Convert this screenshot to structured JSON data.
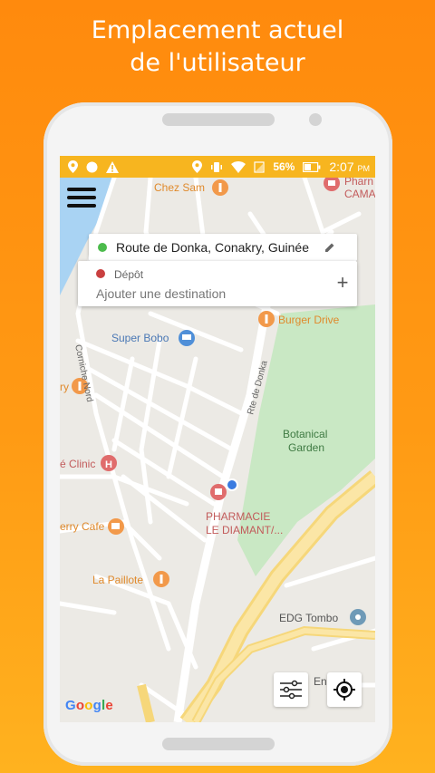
{
  "headline": {
    "line1": "Emplacement actuel",
    "line2": "de l'utilisateur"
  },
  "statusbar": {
    "battery": "56%",
    "time": "2:07",
    "ampm": "PM"
  },
  "route": {
    "origin": "Route de Donka, Conakry, Guinée"
  },
  "destination": {
    "label": "Dépôt",
    "placeholder": "Ajouter une destination",
    "add": "+"
  },
  "map": {
    "places": {
      "chez_sam": "Chez Sam",
      "pharm_top_1": "Pharn",
      "pharm_top_2": "CAMA",
      "burger_drive": "Burger Drive",
      "super_bobo": "Super Bobo",
      "corniche": "Corniche Nord",
      "rte_donka": "Rte de Donka",
      "ry": "ry",
      "botanical_1": "Botanical",
      "botanical_2": "Garden",
      "clinic": "é Clinic",
      "pharmacie_1": "PHARMACIE",
      "pharmacie_2": "LE DIAMANT/...",
      "cafe": "erry Cafe",
      "paillote": "La Paillote",
      "edg": "EDG Tombo",
      "en": "En"
    },
    "attribution": {
      "G": "G",
      "o1": "o",
      "o2": "o",
      "g": "g",
      "l": "l",
      "e": "e"
    }
  },
  "colors": {
    "accent": "#f7b51f",
    "background_top": "#ff8a0d",
    "background_bottom": "#ffb21f",
    "park": "#c9e8c4",
    "water": "#a9d3f3",
    "poi_orange": "#f2994a",
    "poi_blue": "#4f8fd8",
    "poi_red": "#e06c6c",
    "location_dot": "#3a7be0"
  }
}
